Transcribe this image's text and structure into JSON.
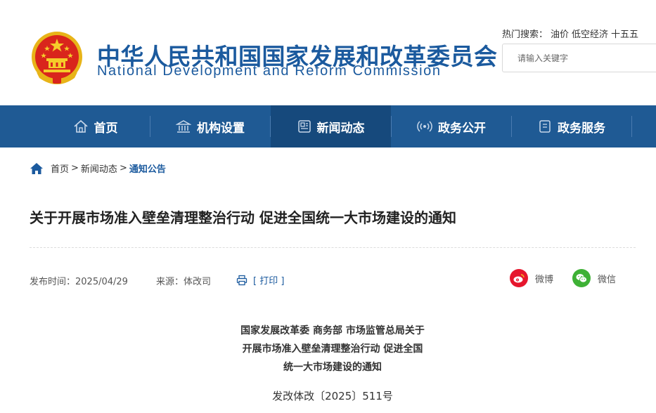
{
  "header": {
    "title_cn": "中华人民共和国国家发展和改革委员会",
    "title_en": "National Development and Reform Commission",
    "hot_label": "热门搜索：",
    "hot_items": [
      "油价",
      "低空经济",
      "十五五"
    ],
    "search_placeholder": "请输入关键字"
  },
  "nav": {
    "items": [
      {
        "label": "首页",
        "icon": "home-icon"
      },
      {
        "label": "机构设置",
        "icon": "building-icon"
      },
      {
        "label": "新闻动态",
        "icon": "news-icon",
        "active": true
      },
      {
        "label": "政务公开",
        "icon": "broadcast-icon"
      },
      {
        "label": "政务服务",
        "icon": "document-icon"
      }
    ]
  },
  "breadcrumb": {
    "items": [
      "首页",
      "新闻动态",
      "通知公告"
    ],
    "separator": ">"
  },
  "article": {
    "title": "关于开展市场准入壁垒清理整治行动 促进全国统一大市场建设的通知",
    "publish_time": "发布时间：2025/04/29",
    "source": "来源：体改司",
    "print_label": "[ 打印 ]",
    "share": [
      {
        "label": "微博",
        "icon": "weibo-icon",
        "color": "#e6162d"
      },
      {
        "label": "微信",
        "icon": "wechat-icon",
        "color": "#3eb135"
      }
    ],
    "doc_heading_lines": [
      "国家发展改革委 商务部 市场监管总局关于",
      "开展市场准入壁垒清理整治行动 促进全国",
      "统一大市场建设的通知"
    ],
    "doc_number": "发改体改〔2025〕511号"
  },
  "colors": {
    "brand_blue": "#1b5a9e",
    "nav_bg": "#1f5a94",
    "nav_active_bg": "#16497c"
  }
}
